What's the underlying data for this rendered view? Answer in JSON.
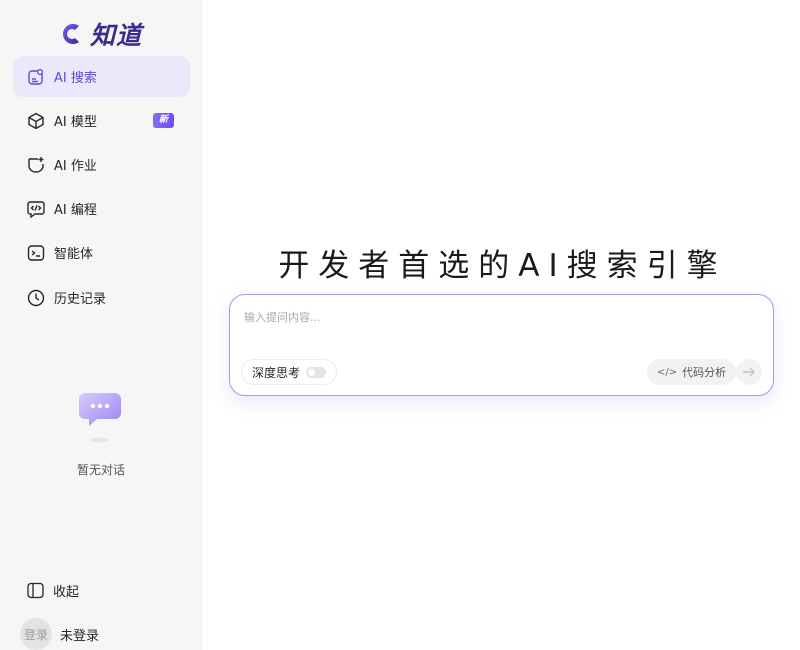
{
  "brand": {
    "name": "知道",
    "accent": "#5b4bd6"
  },
  "sidebar": {
    "items": [
      {
        "label": "AI 搜索",
        "icon": "search-doc-icon",
        "active": true
      },
      {
        "label": "AI 模型",
        "icon": "cube-icon",
        "badge": "新"
      },
      {
        "label": "AI 作业",
        "icon": "shield-sparkle-icon"
      },
      {
        "label": "AI 编程",
        "icon": "code-chat-icon"
      },
      {
        "label": "智能体",
        "icon": "terminal-icon"
      },
      {
        "label": "历史记录",
        "icon": "clock-icon"
      }
    ],
    "empty_text": "暂无对话",
    "collapse_label": "收起"
  },
  "user": {
    "avatar_text": "登录",
    "name": "未登录"
  },
  "main": {
    "headline": "开发者首选的AI搜索引擎",
    "input_placeholder": "输入提问内容...",
    "deep_think_label": "深度思考",
    "code_analysis_label": "代码分析",
    "code_icon_glyph": "</>"
  }
}
